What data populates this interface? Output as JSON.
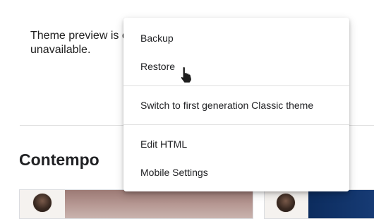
{
  "preview": {
    "line1": "Theme preview is c",
    "line2": "unavailable."
  },
  "section": {
    "title": "Contempo"
  },
  "menu": {
    "items": [
      {
        "label": "Backup"
      },
      {
        "label": "Restore"
      },
      {
        "label": "Switch to first generation Classic theme"
      },
      {
        "label": "Edit HTML"
      },
      {
        "label": "Mobile Settings"
      }
    ]
  },
  "cursor": {
    "icon": "hand-pointer-icon"
  },
  "colors": {
    "text": "#202124",
    "divider": "#e0e0e0",
    "menu_bg": "#ffffff"
  }
}
